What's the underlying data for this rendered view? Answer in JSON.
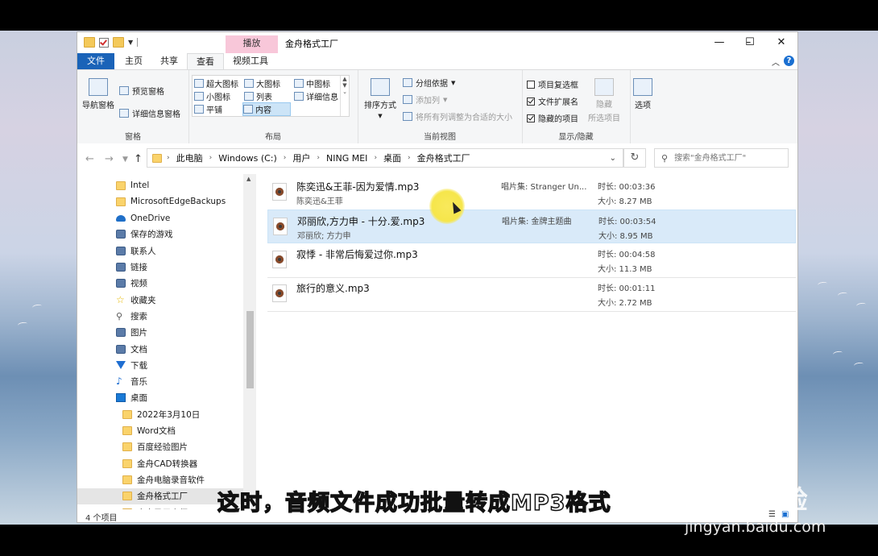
{
  "window": {
    "title": "金舟格式工厂",
    "context_tab_header": "播放"
  },
  "tabs": {
    "file": "文件",
    "home": "主页",
    "share": "共享",
    "view": "查看",
    "video_tools": "视频工具"
  },
  "ribbon": {
    "panes": {
      "nav_pane": "导航窗格",
      "preview": "预览窗格",
      "details": "详细信息窗格",
      "label": "窗格"
    },
    "layout": {
      "label": "布局",
      "items": [
        "超大图标",
        "大图标",
        "中图标",
        "小图标",
        "列表",
        "详细信息",
        "平铺",
        "内容"
      ]
    },
    "current_view": {
      "label": "当前视图",
      "sort": "排序方式",
      "group_by": "分组依据",
      "add_column": "添加列",
      "fit_columns": "将所有列调整为合适的大小"
    },
    "show_hide": {
      "label": "显示/隐藏",
      "item_checkboxes": "项目复选框",
      "file_ext": "文件扩展名",
      "hidden_items": "隐藏的项目",
      "hide": "隐藏",
      "selected_items": "所选项目",
      "options": "选项"
    }
  },
  "address": {
    "crumbs": [
      "此电脑",
      "Windows (C:)",
      "用户",
      "NING MEI",
      "桌面",
      "金舟格式工厂"
    ],
    "search_placeholder": "搜索\"金舟格式工厂\""
  },
  "nav": {
    "items": [
      {
        "label": "Intel",
        "icon": "folder"
      },
      {
        "label": "MicrosoftEdgeBackups",
        "icon": "folder"
      },
      {
        "label": "OneDrive",
        "icon": "cloud"
      },
      {
        "label": "保存的游戏",
        "icon": "sys"
      },
      {
        "label": "联系人",
        "icon": "sys"
      },
      {
        "label": "链接",
        "icon": "sys"
      },
      {
        "label": "视频",
        "icon": "sys"
      },
      {
        "label": "收藏夹",
        "icon": "star"
      },
      {
        "label": "搜索",
        "icon": "srch"
      },
      {
        "label": "图片",
        "icon": "sys"
      },
      {
        "label": "文档",
        "icon": "sys"
      },
      {
        "label": "下载",
        "icon": "down"
      },
      {
        "label": "音乐",
        "icon": "music"
      },
      {
        "label": "桌面",
        "icon": "desk"
      },
      {
        "label": "2022年3月10日",
        "icon": "folder"
      },
      {
        "label": "Word文档",
        "icon": "folder"
      },
      {
        "label": "百度经验图片",
        "icon": "folder"
      },
      {
        "label": "金舟CAD转换器",
        "icon": "folder"
      },
      {
        "label": "金舟电脑录音软件",
        "icon": "folder"
      },
      {
        "label": "金舟格式工厂",
        "icon": "folder"
      },
      {
        "label": "金舟录屏大师",
        "icon": "folder"
      }
    ]
  },
  "files": [
    {
      "name": "陈奕迅&王菲-因为爱情.mp3",
      "artist": "陈奕迅&王菲",
      "album": "唱片集: Stranger Un...",
      "duration": "时长: 00:03:36",
      "size": "大小: 8.27 MB"
    },
    {
      "name": "邓丽欣,方力申 - 十分.爱.mp3",
      "artist": "邓丽欣; 方力申",
      "album": "唱片集: 金牌主题曲",
      "duration": "时长: 00:03:54",
      "size": "大小: 8.95 MB"
    },
    {
      "name": "寂悸 - 非常后悔爱过你.mp3",
      "artist": "",
      "album": "",
      "duration": "时长: 00:04:58",
      "size": "大小: 11.3 MB"
    },
    {
      "name": "旅行的意义.mp3",
      "artist": "",
      "album": "",
      "duration": "时长: 00:01:11",
      "size": "大小: 2.72 MB"
    }
  ],
  "status": {
    "count": "4 个项目"
  },
  "overlay": {
    "subtitle": "这时，音频文件成功批量转成MP3格式",
    "watermark_logo": "Baidu经验",
    "watermark_url": "jingyan.baidu.com"
  },
  "colors": {
    "file_tab": "#1a63b8",
    "context_header": "#f8c7d9",
    "selection": "#d9eaf9"
  }
}
